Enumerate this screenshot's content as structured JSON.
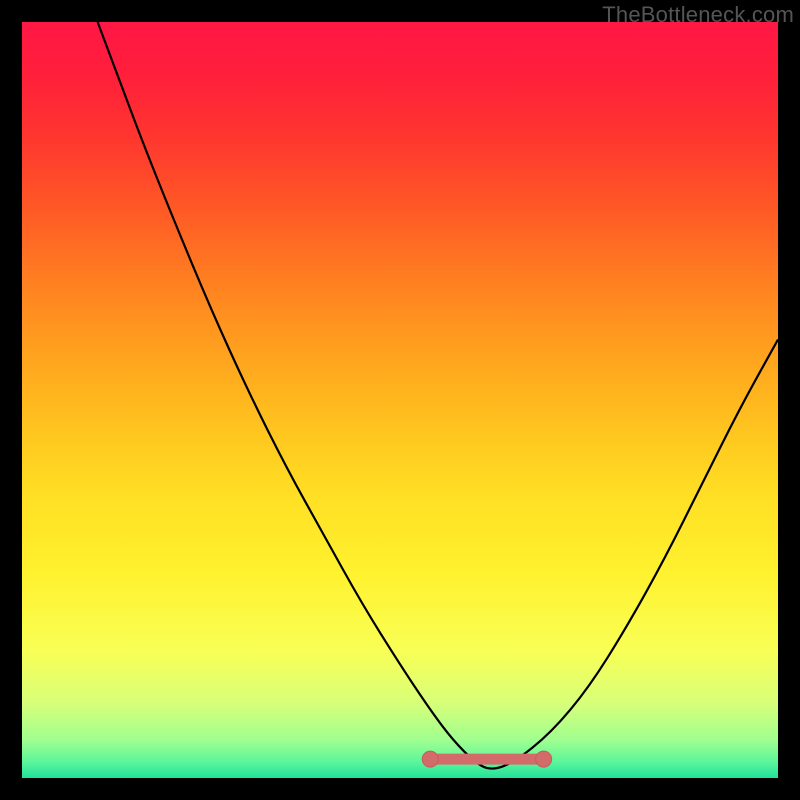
{
  "attribution": "TheBottleneck.com",
  "colors": {
    "black": "#000000",
    "attribution_text": "#555555",
    "gradient_stops": [
      {
        "offset": 0.0,
        "color": "#ff1745"
      },
      {
        "offset": 0.07,
        "color": "#ff1f3b"
      },
      {
        "offset": 0.15,
        "color": "#ff352f"
      },
      {
        "offset": 0.25,
        "color": "#ff5a26"
      },
      {
        "offset": 0.35,
        "color": "#ff8220"
      },
      {
        "offset": 0.45,
        "color": "#ffa61e"
      },
      {
        "offset": 0.55,
        "color": "#ffc81f"
      },
      {
        "offset": 0.63,
        "color": "#ffe024"
      },
      {
        "offset": 0.73,
        "color": "#fff22f"
      },
      {
        "offset": 0.83,
        "color": "#f9ff55"
      },
      {
        "offset": 0.9,
        "color": "#d8ff78"
      },
      {
        "offset": 0.95,
        "color": "#a0ff90"
      },
      {
        "offset": 0.98,
        "color": "#58f59a"
      },
      {
        "offset": 1.0,
        "color": "#22e09a"
      }
    ],
    "curve": "#000000",
    "marker_fill": "#d36b6b",
    "marker_stroke": "#c95a5a"
  },
  "chart_data": {
    "type": "line",
    "title": "",
    "xlabel": "",
    "ylabel": "",
    "xlim": [
      0,
      100
    ],
    "ylim": [
      0,
      100
    ],
    "grid": false,
    "series": [
      {
        "name": "bottleneck-curve",
        "x": [
          10,
          13,
          16,
          20,
          25,
          30,
          35,
          40,
          45,
          50,
          54,
          57,
          60,
          62,
          65,
          70,
          75,
          80,
          85,
          90,
          95,
          100
        ],
        "y": [
          100,
          92,
          84,
          74,
          62,
          51,
          41,
          32,
          23,
          15,
          9,
          5,
          2,
          1,
          2,
          6,
          12,
          20,
          29,
          39,
          49,
          58
        ]
      }
    ],
    "flat_region": {
      "x": [
        54,
        69
      ],
      "y": [
        2.5,
        2.5
      ]
    },
    "markers": [
      {
        "x": 54,
        "y": 2.5
      },
      {
        "x": 69,
        "y": 2.5
      }
    ]
  }
}
